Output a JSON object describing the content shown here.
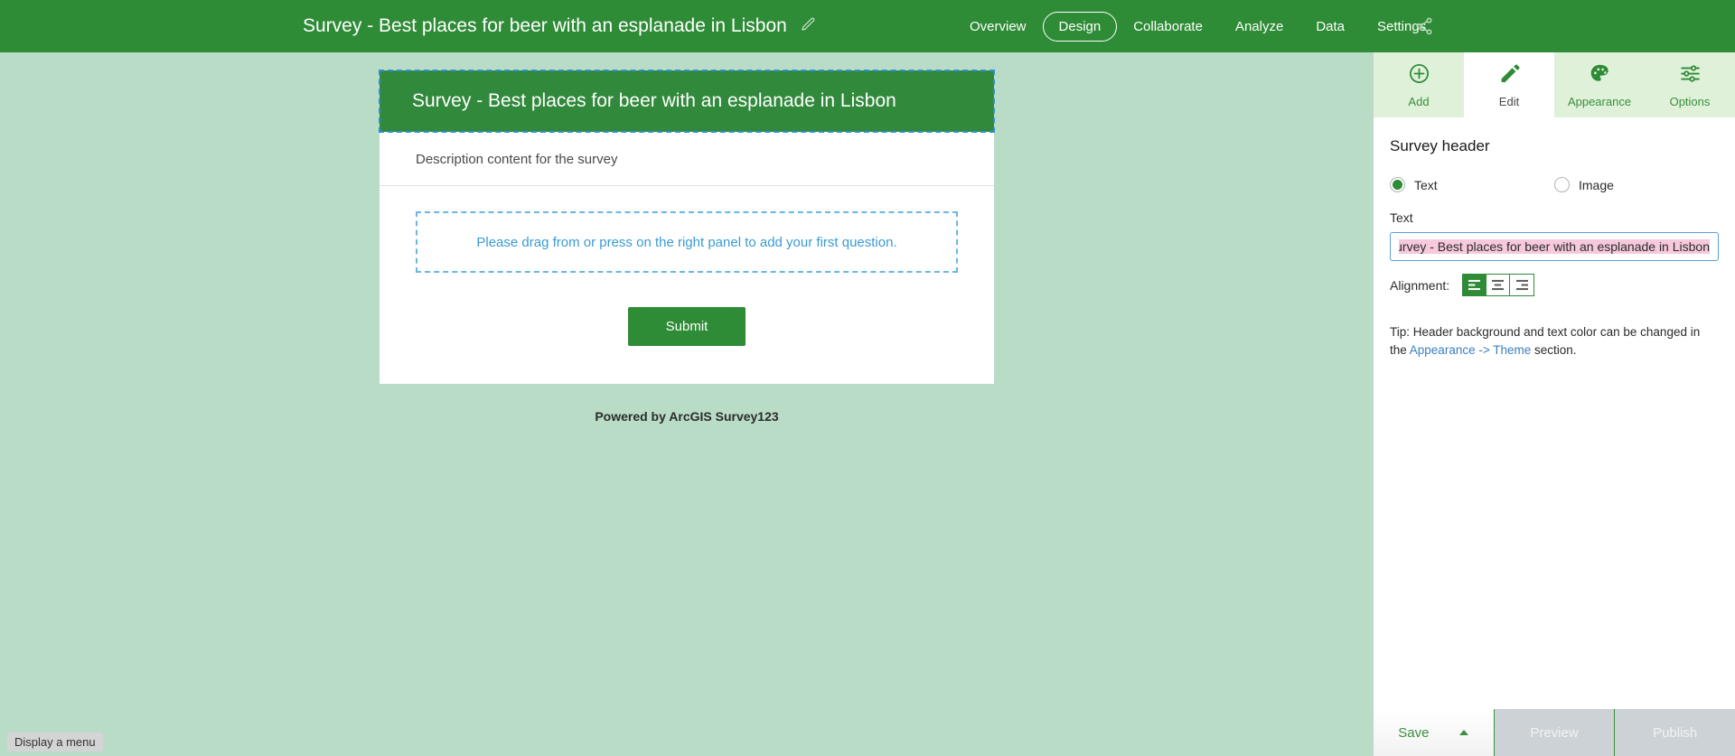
{
  "topbar": {
    "title": "Survey - Best places for beer with an esplanade in Lisbon",
    "edit_title_icon": "pencil-icon",
    "share_icon": "share-nodes-icon",
    "nav": [
      {
        "label": "Overview",
        "active": false
      },
      {
        "label": "Design",
        "active": true
      },
      {
        "label": "Collaborate",
        "active": false
      },
      {
        "label": "Analyze",
        "active": false
      },
      {
        "label": "Data",
        "active": false
      },
      {
        "label": "Settings",
        "active": false
      }
    ]
  },
  "canvas": {
    "survey_header_title": "Survey - Best places for beer with an esplanade in Lisbon",
    "description": "Description content for the survey",
    "dropzone_text": "Please drag from or press on the right panel to add your first question.",
    "submit_label": "Submit",
    "powered_by": "Powered by ArcGIS Survey123"
  },
  "tooltip": {
    "text": "Display a menu"
  },
  "panel": {
    "tabs": [
      {
        "label": "Add",
        "icon": "plus-circle-icon",
        "active": false
      },
      {
        "label": "Edit",
        "icon": "pencil-icon",
        "active": true
      },
      {
        "label": "Appearance",
        "icon": "palette-icon",
        "active": false
      },
      {
        "label": "Options",
        "icon": "sliders-icon",
        "active": false
      }
    ],
    "section_title": "Survey header",
    "source_options": [
      {
        "label": "Text",
        "selected": true
      },
      {
        "label": "Image",
        "selected": false
      }
    ],
    "text_field_label": "Text",
    "text_field_value": "Survey - Best places for beer with an esplanade in Lisbon",
    "text_field_placeholder": "",
    "alignment_label": "Alignment:",
    "alignment_options": [
      {
        "name": "align-left",
        "active": true
      },
      {
        "name": "align-center",
        "active": false
      },
      {
        "name": "align-right",
        "active": false
      }
    ],
    "tip_prefix": "Tip: Header background and text color can be changed in the ",
    "tip_link": "Appearance -> Theme",
    "tip_suffix": " section."
  },
  "footer": {
    "save_label": "Save",
    "preview_label": "Preview",
    "publish_label": "Publish"
  },
  "colors": {
    "brand_green": "#2e8b36",
    "header_green": "#31893c",
    "canvas_bg": "#b9dcc7",
    "tab_inactive_bg": "#dff1d9",
    "link_blue": "#3a7fc1",
    "dropzone_blue": "#3a9bd4",
    "selection_pink": "#f6c9dd",
    "disabled_grey": "#cdd2d6"
  }
}
